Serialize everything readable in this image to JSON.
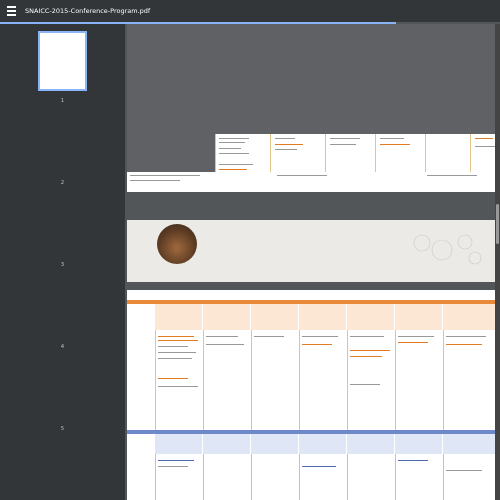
{
  "app": {
    "title": "SNAICC-2015-Conference-Program.pdf",
    "menu_icon": "hamburger-menu-icon"
  },
  "sidebar": {
    "pages": [
      {
        "label": "1"
      },
      {
        "label": "2"
      },
      {
        "label": "3"
      },
      {
        "label": "4"
      },
      {
        "label": "5"
      }
    ]
  },
  "colors": {
    "toolbar": "#323639",
    "viewer_bg": "#525659",
    "accent": "#8ab4f8",
    "orange": "#e98a3a",
    "blue": "#6f88c9"
  }
}
